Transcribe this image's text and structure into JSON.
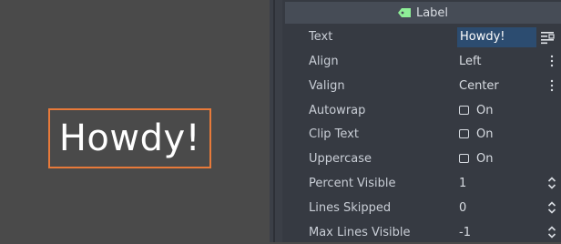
{
  "viewport": {
    "label_text": "Howdy!",
    "selection_color": "#e87a3a"
  },
  "inspector": {
    "section_title": "Label",
    "section_icon": "label-node-icon",
    "section_icon_color": "#8eef97",
    "properties": [
      {
        "name": "Text",
        "value": "Howdy!",
        "control": "text-edit"
      },
      {
        "name": "Align",
        "value": "Left",
        "control": "dropdown"
      },
      {
        "name": "Valign",
        "value": "Center",
        "control": "dropdown"
      },
      {
        "name": "Autowrap",
        "value": "On",
        "control": "checkbox",
        "checked": false
      },
      {
        "name": "Clip Text",
        "value": "On",
        "control": "checkbox",
        "checked": false
      },
      {
        "name": "Uppercase",
        "value": "On",
        "control": "checkbox",
        "checked": false
      },
      {
        "name": "Percent Visible",
        "value": "1",
        "control": "spinbox"
      },
      {
        "name": "Lines Skipped",
        "value": "0",
        "control": "spinbox"
      },
      {
        "name": "Max Lines Visible",
        "value": "-1",
        "control": "spinbox"
      }
    ]
  }
}
